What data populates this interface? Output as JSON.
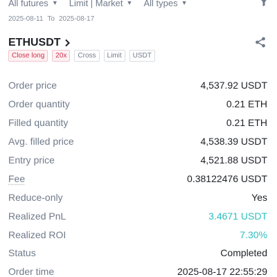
{
  "filters": [
    {
      "label": "All futures"
    },
    {
      "label": "Limit | Market"
    },
    {
      "label": "All types"
    }
  ],
  "date_range": {
    "start": "2025-08-11",
    "to_label": "To",
    "end": "2025-08-17"
  },
  "order": {
    "symbol": "ETHUSDT",
    "tags": [
      "Close long",
      "20x",
      "Cross",
      "Limit",
      "USDT"
    ],
    "details": [
      {
        "label": "Order price",
        "value": "4,537.92 USDT"
      },
      {
        "label": "Order quantity",
        "value": "0.21 ETH"
      },
      {
        "label": "Filled quantity",
        "value": "0.21 ETH"
      },
      {
        "label": "Avg. filled price",
        "value": "4,538.39 USDT"
      },
      {
        "label": "Entry price",
        "value": "4,521.88 USDT"
      },
      {
        "label": "Fee",
        "value": "0.38122476 USDT"
      },
      {
        "label": "Reduce-only",
        "value": "Yes"
      },
      {
        "label": "Realized PnL",
        "value": "3.4671 USDT"
      },
      {
        "label": "Realized ROI",
        "value": "7.30%"
      },
      {
        "label": "Status",
        "value": "Completed"
      },
      {
        "label": "Order time",
        "value": "2025-08-17 22:55:29"
      }
    ]
  },
  "colors": {
    "positive": "#2ebfbf",
    "close_long_tag": "#cf304a"
  },
  "icons": {
    "filter": "funnel-icon",
    "share": "share-icon",
    "symbol_link": "chevron-right-icon"
  }
}
